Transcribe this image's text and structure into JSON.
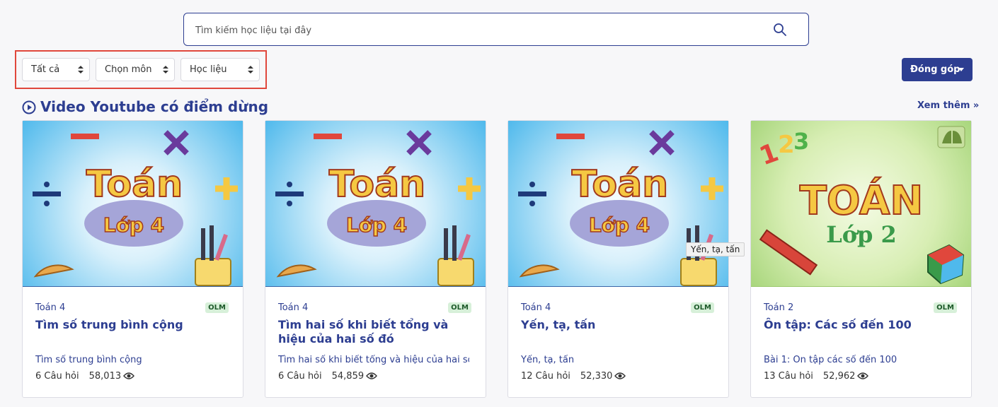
{
  "search": {
    "placeholder": "Tìm kiếm học liệu tại đây"
  },
  "filters": {
    "grade": "Tất cả",
    "subject": "Chọn môn",
    "type": "Học liệu"
  },
  "contribute_label": "Đóng góp",
  "section": {
    "title": "Video Youtube có điểm dừng",
    "see_more": "Xem thêm »"
  },
  "cards": [
    {
      "thumb_big": "Toán",
      "thumb_small": "Lớp 4",
      "subject": "Toán 4",
      "badge": "OLM",
      "title": "Tìm số trung bình cộng",
      "desc": "Tìm số trung bình cộng",
      "questions": "6 Câu hỏi",
      "views": "58,013"
    },
    {
      "thumb_big": "Toán",
      "thumb_small": "Lớp 4",
      "subject": "Toán 4",
      "badge": "OLM",
      "title": "Tìm hai số khi biết tổng và hiệu của hai số đó",
      "desc": "Tìm hai số khi biết tổng và hiệu của hai số...",
      "questions": "6 Câu hỏi",
      "views": "54,859"
    },
    {
      "thumb_big": "Toán",
      "thumb_small": "Lớp 4",
      "subject": "Toán 4",
      "badge": "OLM",
      "title": "Yến, tạ, tấn",
      "desc": "Yến, tạ, tấn",
      "questions": "12 Câu hỏi",
      "views": "52,330"
    },
    {
      "thumb_big": "TOÁN",
      "thumb_small": "Lớp 2",
      "subject": "Toán 2",
      "badge": "OLM",
      "title": "Ôn tập: Các số đến 100",
      "desc": "Bài 1: Ôn tập các số đến 100",
      "questions": "13 Câu hỏi",
      "views": "52,962"
    }
  ],
  "tooltip": "Yến, tạ, tấn",
  "colors": {
    "primary": "#2d3e91",
    "highlight_border": "#e0473c",
    "badge_bg": "#d7f0d9"
  }
}
